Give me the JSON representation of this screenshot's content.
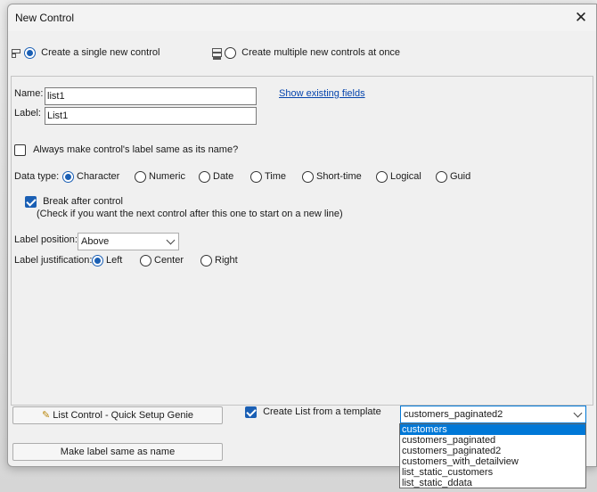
{
  "window": {
    "title": "New Control",
    "close_glyph": "✕"
  },
  "mode": {
    "single_label": "Create a single new control",
    "single_selected": true,
    "multiple_label": "Create multiple new controls at once",
    "multiple_selected": false
  },
  "fields": {
    "name_label": "Name:",
    "name_value": "list1",
    "label_label": "Label:",
    "label_value": "List1",
    "show_existing_link": "Show existing fields"
  },
  "always_same_label": {
    "text": "Always make control's label same as its name?",
    "checked": false
  },
  "data_type": {
    "label": "Data type:",
    "options": [
      "Character",
      "Numeric",
      "Date",
      "Time",
      "Short-time",
      "Logical",
      "Guid"
    ],
    "selected": "Character"
  },
  "break_after": {
    "text": "Break after control",
    "hint": "(Check if you want the next control after this one to start on a new line)",
    "checked": true
  },
  "label_position": {
    "label": "Label position:",
    "value": "Above"
  },
  "label_justification": {
    "label": "Label justification:",
    "options": [
      "Left",
      "Center",
      "Right"
    ],
    "selected": "Left"
  },
  "buttons": {
    "quick_setup": "List Control - Quick Setup Genie",
    "make_label_same": "Make label same as name"
  },
  "template": {
    "checkbox_label": "Create List from a template",
    "checked": true,
    "selected_value": "customers_paginated2",
    "dropdown_items": [
      "customers",
      "customers_paginated",
      "customers_paginated2",
      "customers_with_detailview",
      "list_static_customers",
      "list_static_ddata"
    ],
    "highlighted_index": 0
  },
  "colors": {
    "accent": "#1a5fb4",
    "link": "#0645ad",
    "selection": "#0078d7"
  }
}
